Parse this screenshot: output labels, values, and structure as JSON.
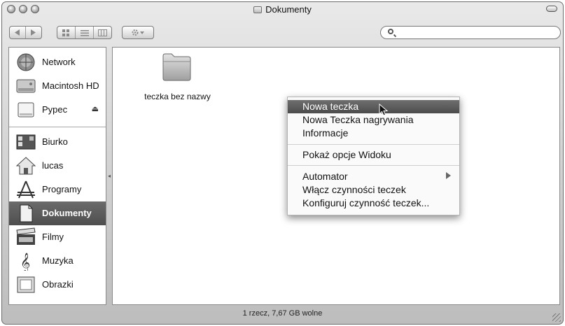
{
  "window": {
    "title": "Dokumenty"
  },
  "toolbar": {
    "search_placeholder": ""
  },
  "sidebar": {
    "devices": [
      {
        "label": "Network",
        "icon": "network-icon"
      },
      {
        "label": "Macintosh HD",
        "icon": "hard-drive-icon"
      },
      {
        "label": "Pypec",
        "icon": "disk-icon",
        "eject": "⏏"
      }
    ],
    "places": [
      {
        "label": "Biurko",
        "icon": "desktop-icon"
      },
      {
        "label": "lucas",
        "icon": "home-icon"
      },
      {
        "label": "Programy",
        "icon": "applications-icon"
      },
      {
        "label": "Dokumenty",
        "icon": "documents-icon",
        "selected": true
      },
      {
        "label": "Filmy",
        "icon": "movies-icon"
      },
      {
        "label": "Muzyka",
        "icon": "music-icon"
      },
      {
        "label": "Obrazki",
        "icon": "pictures-icon"
      }
    ]
  },
  "content": {
    "items": [
      {
        "label": "teczka bez nazwy",
        "icon": "folder-icon"
      }
    ]
  },
  "context_menu": {
    "items": [
      {
        "label": "Nowa teczka",
        "highlighted": true
      },
      {
        "label": "Nowa Teczka nagrywania"
      },
      {
        "label": "Informacje"
      },
      {
        "label": "Pokaż opcje Widoku"
      },
      {
        "label": "Automator",
        "submenu": true
      },
      {
        "label": "Włącz czynności teczek"
      },
      {
        "label": "Konfiguruj czynność teczek..."
      }
    ]
  },
  "status": {
    "text": "1 rzecz, 7,67 GB wolne"
  },
  "colors": {
    "highlight": "#5a5a5a",
    "metal": "#d0d0d0"
  }
}
